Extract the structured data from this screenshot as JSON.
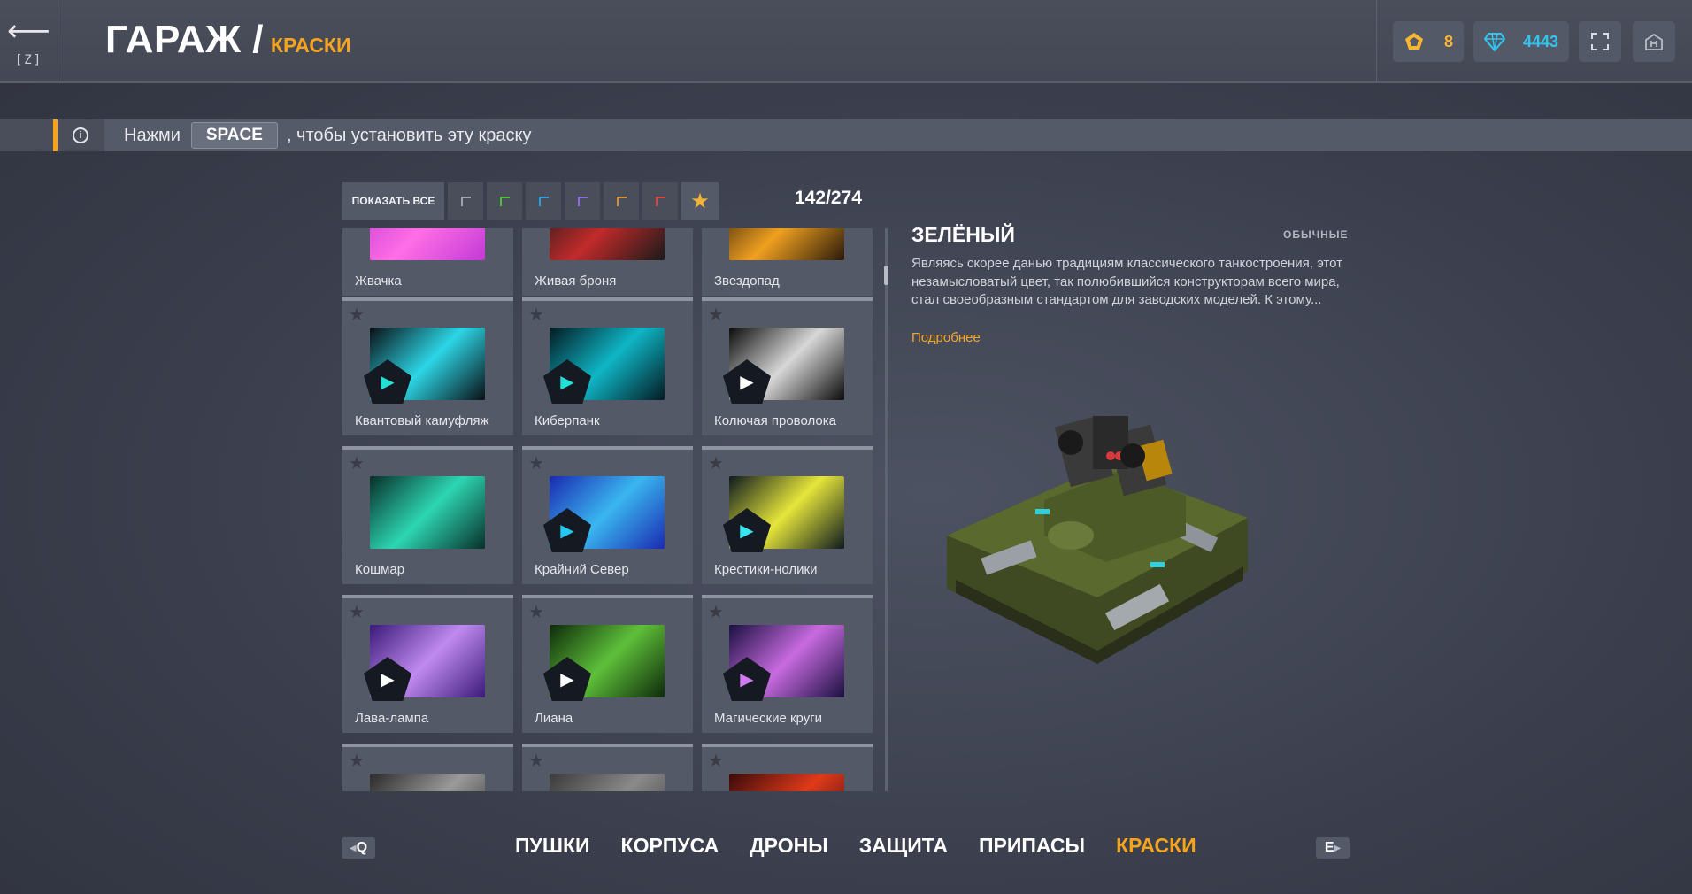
{
  "header": {
    "back_key": "[Z]",
    "title": "ГАРАЖ /",
    "subtitle": "КРАСКИ",
    "crystals": "8",
    "diamonds": "4443"
  },
  "hint": {
    "before": "Нажми",
    "key": "SPACE",
    "after": ", чтобы установить эту краску"
  },
  "filters": {
    "show_all": "ПОКАЗАТЬ ВСЕ",
    "rarity_colors": [
      "#9ea3ae",
      "#4fbf3a",
      "#2d9de0",
      "#8a6fe0",
      "#d7902e",
      "#e0443a"
    ],
    "favorite_color": "#f0b43a",
    "count": "142/274"
  },
  "paints": [
    {
      "name": "Жвачка",
      "colors": [
        "#c23ad6",
        "#ff6ee6"
      ]
    },
    {
      "name": "Живая броня",
      "colors": [
        "#1a1a1a",
        "#c22a2a"
      ]
    },
    {
      "name": "Звездопад",
      "colors": [
        "#2a1a0a",
        "#f0a020"
      ]
    },
    {
      "name": "Квантовый камуфляж",
      "colors": [
        "#0a0f14",
        "#2cd6e6"
      ],
      "icon_color": "#24e0d4"
    },
    {
      "name": "Киберпанк",
      "colors": [
        "#041a22",
        "#0fb6c6"
      ],
      "icon_color": "#24e0d4"
    },
    {
      "name": "Колючая проволока",
      "colors": [
        "#0b0b0b",
        "#d8d8d8"
      ],
      "icon_color": "#ffffff"
    },
    {
      "name": "Кошмар",
      "colors": [
        "#08302a",
        "#2dd6b2"
      ]
    },
    {
      "name": "Крайний Север",
      "colors": [
        "#1a2ab0",
        "#3ab6f0"
      ],
      "icon_color": "#24c8ee"
    },
    {
      "name": "Крестики-нолики",
      "colors": [
        "#0e1a1e",
        "#e6e63a"
      ],
      "icon_color": "#3ae6f0"
    },
    {
      "name": "Лава-лампа",
      "colors": [
        "#3a1a7a",
        "#c08af0"
      ],
      "icon_color": "#ffffff"
    },
    {
      "name": "Лиана",
      "colors": [
        "#0e2a0a",
        "#5ec03a"
      ],
      "icon_color": "#ffffff"
    },
    {
      "name": "Магические круги",
      "colors": [
        "#1a1040",
        "#c86ae0"
      ],
      "icon_color": "#d07af0"
    },
    {
      "name": "",
      "colors": [
        "#2a2a2a",
        "#9a9a9a"
      ]
    },
    {
      "name": "",
      "colors": [
        "#3a3a3a",
        "#8a8a8a"
      ]
    },
    {
      "name": "",
      "colors": [
        "#3a0a0a",
        "#e03a1a"
      ]
    }
  ],
  "detail": {
    "title": "ЗЕЛЁНЫЙ",
    "rarity": "ОБЫЧНЫЕ",
    "description": "Являясь скорее данью традициям классического танкостроения, этот незамысловатый цвет, так полюбившийся конструкторам всего мира, стал своеобразным стандартом для заводских моделей. К этому...",
    "more": "Подробнее"
  },
  "nav": {
    "prev_key": "Q",
    "next_key": "E",
    "tabs": [
      "ПУШКИ",
      "КОРПУСА",
      "ДРОНЫ",
      "ЗАЩИТА",
      "ПРИПАСЫ",
      "КРАСКИ"
    ],
    "active_tab": "КРАСКИ"
  },
  "colors": {
    "accent": "#f7a41d",
    "diamond": "#2fc6f0",
    "crystal": "#f7b731"
  }
}
